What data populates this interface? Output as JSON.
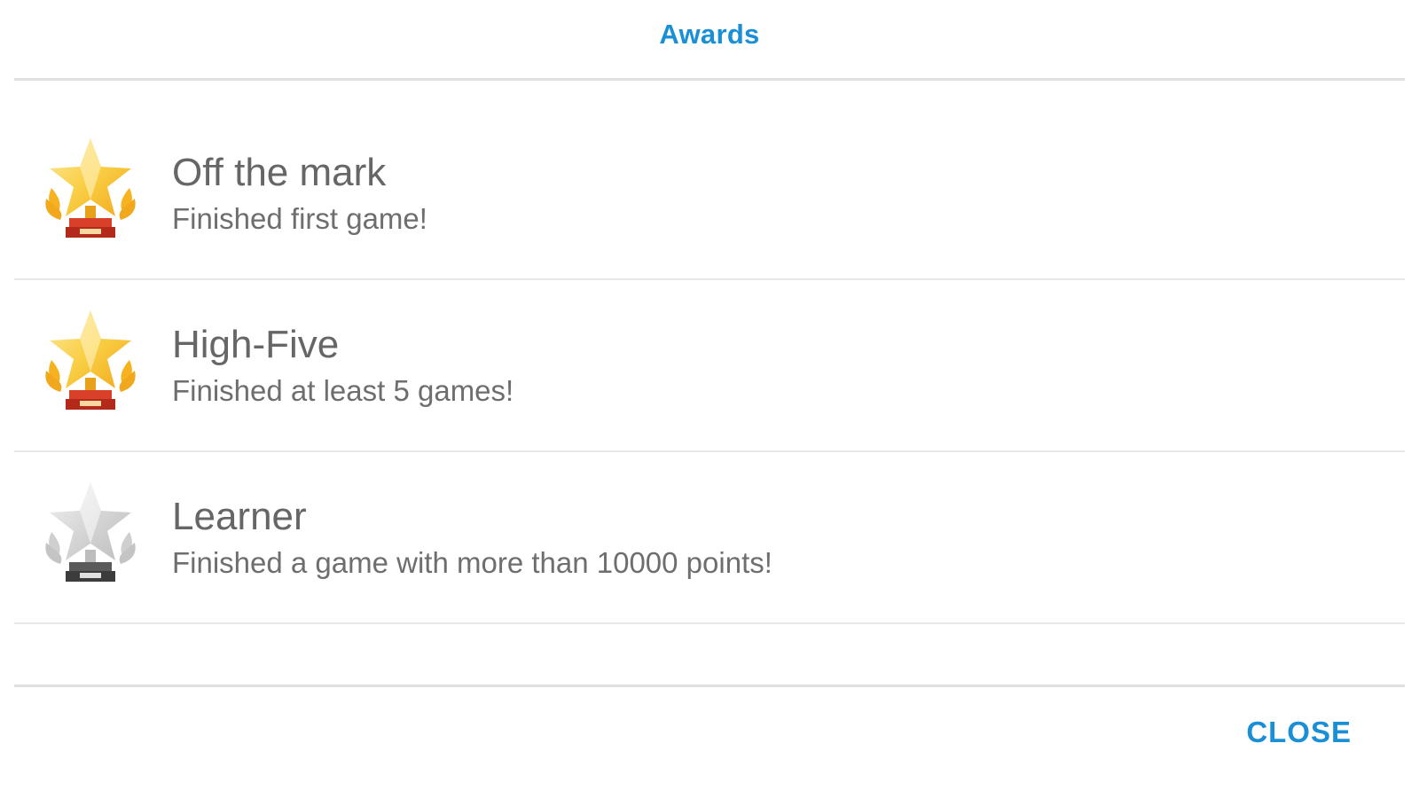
{
  "dialog": {
    "title": "Awards",
    "close_label": "CLOSE",
    "accent_color": "#1a8fd6"
  },
  "awards": [
    {
      "title": "Off the mark",
      "description": "Finished first game!",
      "icon": "gold-trophy-icon",
      "earned": true
    },
    {
      "title": "High-Five",
      "description": "Finished at least 5 games!",
      "icon": "gold-trophy-icon",
      "earned": true
    },
    {
      "title": "Learner",
      "description": "Finished a game with more than 10000 points!",
      "icon": "gray-trophy-icon",
      "earned": false
    }
  ]
}
